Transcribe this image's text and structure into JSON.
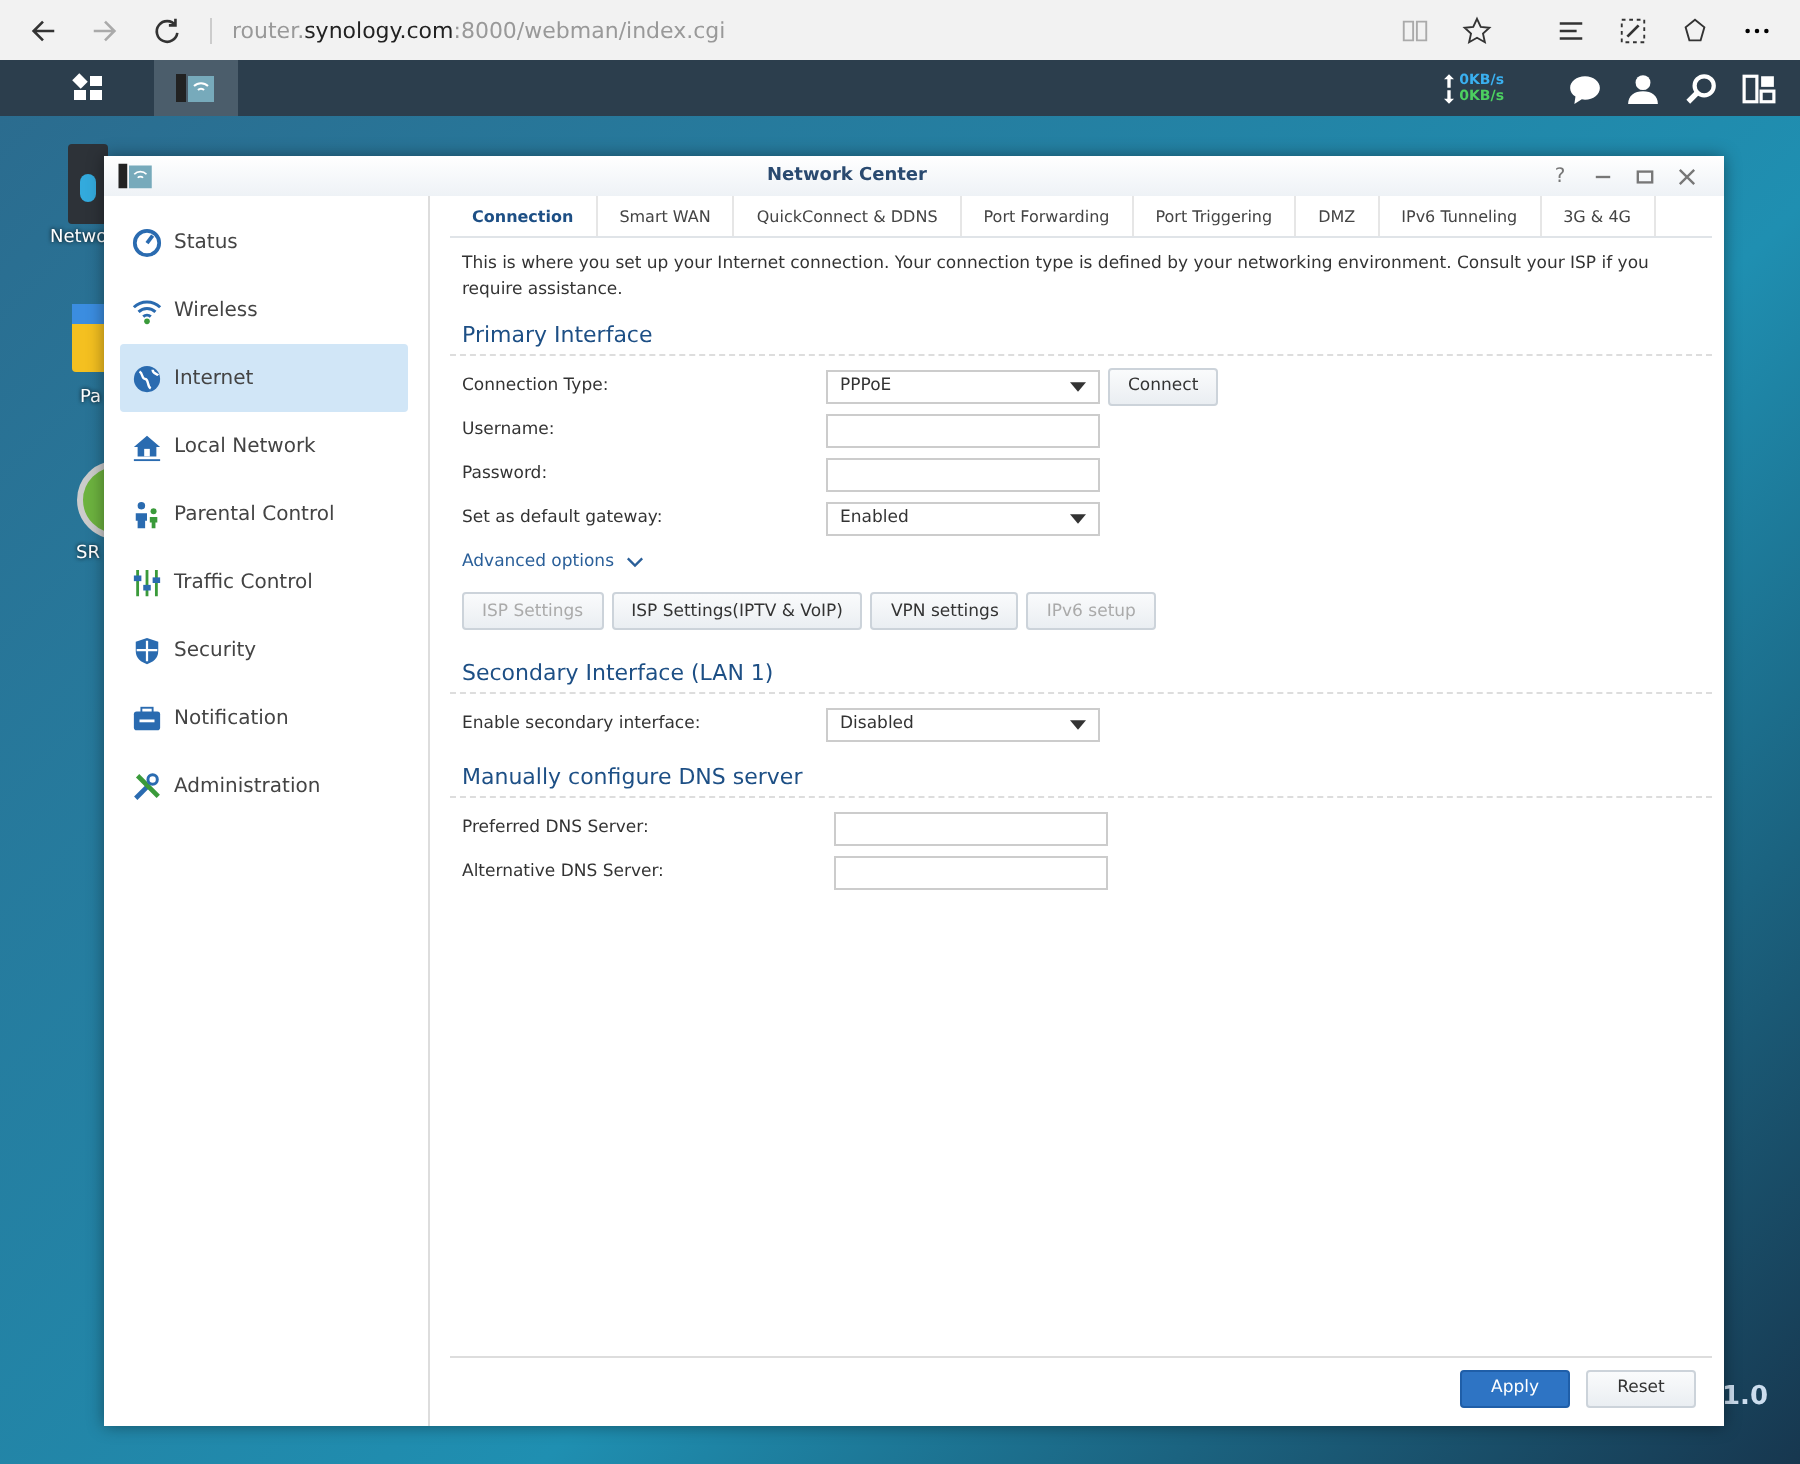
{
  "browser": {
    "url_host": "router.",
    "url_domain": "synology.com",
    "url_path": ":8000/webman/index.cgi"
  },
  "taskbar": {
    "upload": "0KB/s",
    "download": "0KB/s"
  },
  "desktop_icons": [
    {
      "label": "Netwo"
    },
    {
      "label": "Pa"
    },
    {
      "label": "SR"
    }
  ],
  "desktop_version": "1.0",
  "window": {
    "title": "Network Center",
    "help": "?"
  },
  "sidebar": {
    "items": [
      {
        "label": "Status",
        "selected": false
      },
      {
        "label": "Wireless",
        "selected": false
      },
      {
        "label": "Internet",
        "selected": true
      },
      {
        "label": "Local Network",
        "selected": false
      },
      {
        "label": "Parental Control",
        "selected": false
      },
      {
        "label": "Traffic Control",
        "selected": false
      },
      {
        "label": "Security",
        "selected": false
      },
      {
        "label": "Notification",
        "selected": false
      },
      {
        "label": "Administration",
        "selected": false
      }
    ]
  },
  "tabs": [
    {
      "label": "Connection",
      "selected": true
    },
    {
      "label": "Smart WAN",
      "selected": false
    },
    {
      "label": "QuickConnect & DDNS",
      "selected": false
    },
    {
      "label": "Port Forwarding",
      "selected": false
    },
    {
      "label": "Port Triggering",
      "selected": false
    },
    {
      "label": "DMZ",
      "selected": false
    },
    {
      "label": "IPv6 Tunneling",
      "selected": false
    },
    {
      "label": "3G & 4G",
      "selected": false
    }
  ],
  "description": "This is where you set up your Internet connection. Your connection type is defined by your networking environment. Consult your ISP if you require assistance.",
  "sections": [
    {
      "title": "Primary Interface",
      "fields": [
        {
          "kind": "select",
          "label": "Connection Type:",
          "value": "PPPoE",
          "button": "Connect"
        },
        {
          "kind": "input",
          "label": "Username:"
        },
        {
          "kind": "input",
          "label": "Password:"
        },
        {
          "kind": "select",
          "label": "Set as default gateway:",
          "value": "Enabled"
        }
      ],
      "advanced": "Advanced options",
      "buttons": [
        {
          "label": "ISP Settings",
          "disabled": true
        },
        {
          "label": "ISP Settings(IPTV & VoIP)",
          "disabled": false
        },
        {
          "label": "VPN settings",
          "disabled": false
        },
        {
          "label": "IPv6 setup",
          "disabled": true
        }
      ]
    },
    {
      "title": "Secondary Interface (LAN 1)",
      "fields": [
        {
          "kind": "select",
          "label": "Enable secondary interface:",
          "value": "Disabled"
        }
      ]
    },
    {
      "title": "Manually configure DNS server",
      "fields": [
        {
          "kind": "input",
          "label": "Preferred DNS Server:"
        },
        {
          "kind": "input",
          "label": "Alternative DNS Server:"
        }
      ]
    }
  ],
  "footer": {
    "apply": "Apply",
    "reset": "Reset"
  }
}
